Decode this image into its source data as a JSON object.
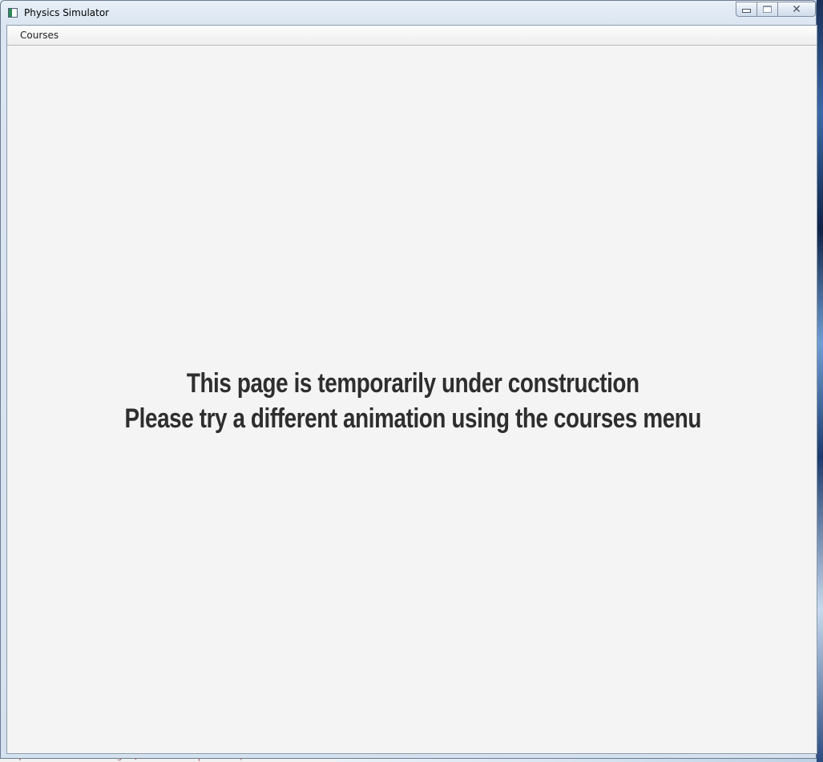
{
  "window": {
    "title": "Physics Simulator",
    "icon": "app-window-icon",
    "caption_buttons": {
      "minimize_icon": "minimize-icon",
      "maximize_icon": "maximize-icon",
      "close_icon": "close-icon",
      "close_glyph": "✕"
    }
  },
  "menubar": {
    "items": [
      {
        "label": "Courses"
      }
    ]
  },
  "content": {
    "line1": "This page is temporarily under construction",
    "line2": "Please try a different animation using the courses menu"
  },
  "background": {
    "console_text": "cKaqe:bean MIBIVE.Changed(Bean MIBI. |SVG.OUL)"
  },
  "colors": {
    "content_background": "#f4f4f4",
    "message_text": "#2e2e2e",
    "console_text": "#b23a3a"
  }
}
